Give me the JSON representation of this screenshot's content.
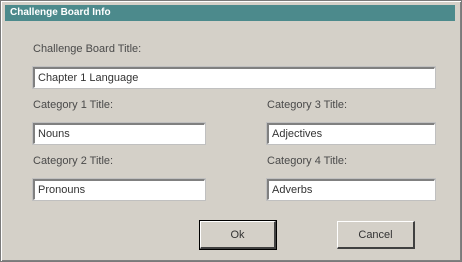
{
  "dialog": {
    "title": "Challenge Board Info"
  },
  "board": {
    "title_label": "Challenge Board Title:",
    "title_value": "Chapter 1 Language"
  },
  "categories": [
    {
      "label": "Category 1 Title:",
      "value": "Nouns"
    },
    {
      "label": "Category 2 Title:",
      "value": "Pronouns"
    },
    {
      "label": "Category 3 Title:",
      "value": "Adjectives"
    },
    {
      "label": "Category 4 Title:",
      "value": "Adverbs"
    }
  ],
  "buttons": {
    "ok_label": "Ok",
    "cancel_label": "Cancel"
  }
}
